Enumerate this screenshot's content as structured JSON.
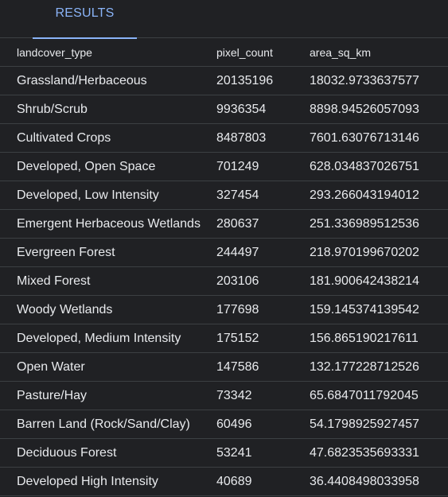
{
  "tabs": [
    {
      "label": "RESULTS"
    }
  ],
  "table": {
    "columns": [
      "landcover_type",
      "pixel_count",
      "area_sq_km"
    ],
    "rows": [
      [
        "Grassland/Herbaceous",
        "20135196",
        "18032.9733637577"
      ],
      [
        "Shrub/Scrub",
        "9936354",
        "8898.94526057093"
      ],
      [
        "Cultivated Crops",
        "8487803",
        "7601.63076713146"
      ],
      [
        "Developed, Open Space",
        "701249",
        "628.034837026751"
      ],
      [
        "Developed, Low Intensity",
        "327454",
        "293.266043194012"
      ],
      [
        "Emergent Herbaceous Wetlands",
        "280637",
        "251.336989512536"
      ],
      [
        "Evergreen Forest",
        "244497",
        "218.970199670202"
      ],
      [
        "Mixed Forest",
        "203106",
        "181.900642438214"
      ],
      [
        "Woody Wetlands",
        "177698",
        "159.145374139542"
      ],
      [
        "Developed, Medium Intensity",
        "175152",
        "156.865190217611"
      ],
      [
        "Open Water",
        "147586",
        "132.177228712526"
      ],
      [
        "Pasture/Hay",
        "73342",
        "65.6847011792045"
      ],
      [
        "Barren Land (Rock/Sand/Clay)",
        "60496",
        "54.1798925927457"
      ],
      [
        "Deciduous Forest",
        "53241",
        "47.6823535693331"
      ],
      [
        "Developed High Intensity",
        "40689",
        "36.4408498033958"
      ]
    ]
  }
}
